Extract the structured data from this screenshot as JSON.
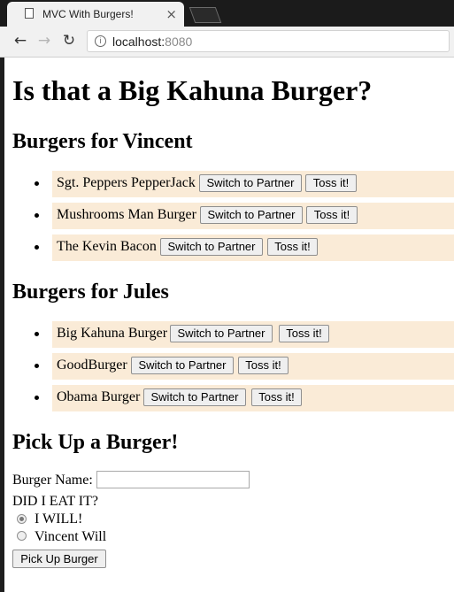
{
  "browser": {
    "tab_title": "MVC With Burgers!",
    "close_glyph": "×",
    "url_host": "localhost:",
    "url_port": "8080",
    "back_glyph": "←",
    "forward_glyph": "→",
    "reload_glyph": "↻",
    "info_glyph": "i"
  },
  "page": {
    "title": "Is that a Big Kahuna Burger?",
    "vincent": {
      "heading": "Burgers for Vincent",
      "items": [
        {
          "name": "Sgt. Peppers PepperJack",
          "switch_label": "Switch to Partner",
          "toss_label": "Toss it!"
        },
        {
          "name": "Mushrooms Man Burger",
          "switch_label": "Switch to Partner",
          "toss_label": "Toss it!"
        },
        {
          "name": "The Kevin Bacon",
          "switch_label": "Switch to Partner",
          "toss_label": "Toss it!"
        }
      ]
    },
    "jules": {
      "heading": "Burgers for Jules",
      "items": [
        {
          "name": "Big Kahuna Burger",
          "switch_label": "Switch to Partner",
          "toss_label": "Toss it!"
        },
        {
          "name": "GoodBurger",
          "switch_label": "Switch to Partner",
          "toss_label": "Toss it!"
        },
        {
          "name": "Obama Burger",
          "switch_label": "Switch to Partner",
          "toss_label": "Toss it!"
        }
      ]
    },
    "form": {
      "heading": "Pick Up a Burger!",
      "name_label": "Burger Name:",
      "name_value": "",
      "question": "DID I EAT IT?",
      "options": [
        {
          "label": "I WILL!",
          "checked": true
        },
        {
          "label": "Vincent Will",
          "checked": false
        }
      ],
      "submit_label": "Pick Up Burger"
    }
  }
}
